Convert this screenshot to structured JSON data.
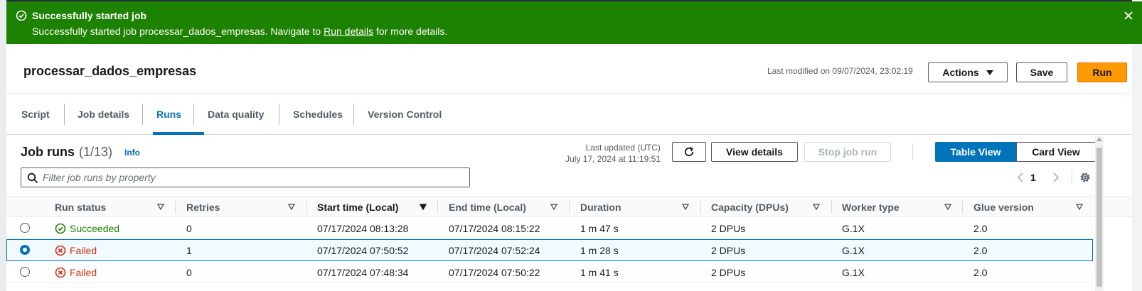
{
  "flash": {
    "title": "Successfully started job",
    "message_prefix": "Successfully started job processar_dados_empresas. Navigate to ",
    "link": "Run details",
    "message_suffix": " for more details.",
    "icons": {
      "status": "check-circle-icon",
      "dismiss": "close-icon"
    },
    "color": "#1d8102"
  },
  "header": {
    "job_name": "processar_dados_empresas",
    "last_modified": "Last modified on 09/07/2024, 23:02:19",
    "actions_label": "Actions",
    "save_label": "Save",
    "run_label": "Run",
    "run_color": "#ff9900"
  },
  "tabs": [
    {
      "label": "Script",
      "active": false
    },
    {
      "label": "Job details",
      "active": false
    },
    {
      "label": "Runs",
      "active": true
    },
    {
      "label": "Data quality",
      "active": false
    },
    {
      "label": "Schedules",
      "active": false
    },
    {
      "label": "Version Control",
      "active": false
    }
  ],
  "job_runs": {
    "title": "Job runs",
    "count": "(1/13)",
    "info": "Info",
    "last_updated_label": "Last updated (UTC)",
    "last_updated_value": "July 17, 2024 at 11:19:51",
    "view_details_label": "View details",
    "stop_label": "Stop job run",
    "table_view_label": "Table View",
    "card_view_label": "Card View",
    "filter_placeholder": "Filter job runs by property",
    "page": "1",
    "accent": "#0073bb"
  },
  "table": {
    "columns": [
      "Run status",
      "Retries",
      "Start time (Local)",
      "End time (Local)",
      "Duration",
      "Capacity (DPUs)",
      "Worker type",
      "Glue version"
    ],
    "sorted_column": "Start time (Local)",
    "rows": [
      {
        "selected": false,
        "status": "Succeeded",
        "retries": "0",
        "start": "07/17/2024 08:13:28",
        "end": "07/17/2024 08:15:22",
        "duration": "1 m 47 s",
        "capacity": "2 DPUs",
        "worker": "G.1X",
        "glue": "2.0"
      },
      {
        "selected": true,
        "status": "Failed",
        "retries": "1",
        "start": "07/17/2024 07:50:52",
        "end": "07/17/2024 07:52:24",
        "duration": "1 m 28 s",
        "capacity": "2 DPUs",
        "worker": "G.1X",
        "glue": "2.0"
      },
      {
        "selected": false,
        "status": "Failed",
        "retries": "0",
        "start": "07/17/2024 07:48:34",
        "end": "07/17/2024 07:50:22",
        "duration": "1 m 41 s",
        "capacity": "2 DPUs",
        "worker": "G.1X",
        "glue": "2.0"
      }
    ],
    "status_colors": {
      "Succeeded": "#1d8102",
      "Failed": "#d13212"
    }
  }
}
